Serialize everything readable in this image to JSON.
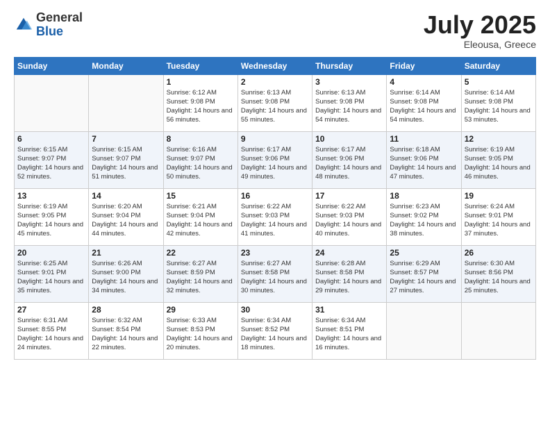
{
  "header": {
    "logo_general": "General",
    "logo_blue": "Blue",
    "month_year": "July 2025",
    "location": "Eleousa, Greece"
  },
  "weekdays": [
    "Sunday",
    "Monday",
    "Tuesday",
    "Wednesday",
    "Thursday",
    "Friday",
    "Saturday"
  ],
  "weeks": [
    [
      {
        "day": "",
        "sunrise": "",
        "sunset": "",
        "daylight": ""
      },
      {
        "day": "",
        "sunrise": "",
        "sunset": "",
        "daylight": ""
      },
      {
        "day": "1",
        "sunrise": "Sunrise: 6:12 AM",
        "sunset": "Sunset: 9:08 PM",
        "daylight": "Daylight: 14 hours and 56 minutes."
      },
      {
        "day": "2",
        "sunrise": "Sunrise: 6:13 AM",
        "sunset": "Sunset: 9:08 PM",
        "daylight": "Daylight: 14 hours and 55 minutes."
      },
      {
        "day": "3",
        "sunrise": "Sunrise: 6:13 AM",
        "sunset": "Sunset: 9:08 PM",
        "daylight": "Daylight: 14 hours and 54 minutes."
      },
      {
        "day": "4",
        "sunrise": "Sunrise: 6:14 AM",
        "sunset": "Sunset: 9:08 PM",
        "daylight": "Daylight: 14 hours and 54 minutes."
      },
      {
        "day": "5",
        "sunrise": "Sunrise: 6:14 AM",
        "sunset": "Sunset: 9:08 PM",
        "daylight": "Daylight: 14 hours and 53 minutes."
      }
    ],
    [
      {
        "day": "6",
        "sunrise": "Sunrise: 6:15 AM",
        "sunset": "Sunset: 9:07 PM",
        "daylight": "Daylight: 14 hours and 52 minutes."
      },
      {
        "day": "7",
        "sunrise": "Sunrise: 6:15 AM",
        "sunset": "Sunset: 9:07 PM",
        "daylight": "Daylight: 14 hours and 51 minutes."
      },
      {
        "day": "8",
        "sunrise": "Sunrise: 6:16 AM",
        "sunset": "Sunset: 9:07 PM",
        "daylight": "Daylight: 14 hours and 50 minutes."
      },
      {
        "day": "9",
        "sunrise": "Sunrise: 6:17 AM",
        "sunset": "Sunset: 9:06 PM",
        "daylight": "Daylight: 14 hours and 49 minutes."
      },
      {
        "day": "10",
        "sunrise": "Sunrise: 6:17 AM",
        "sunset": "Sunset: 9:06 PM",
        "daylight": "Daylight: 14 hours and 48 minutes."
      },
      {
        "day": "11",
        "sunrise": "Sunrise: 6:18 AM",
        "sunset": "Sunset: 9:06 PM",
        "daylight": "Daylight: 14 hours and 47 minutes."
      },
      {
        "day": "12",
        "sunrise": "Sunrise: 6:19 AM",
        "sunset": "Sunset: 9:05 PM",
        "daylight": "Daylight: 14 hours and 46 minutes."
      }
    ],
    [
      {
        "day": "13",
        "sunrise": "Sunrise: 6:19 AM",
        "sunset": "Sunset: 9:05 PM",
        "daylight": "Daylight: 14 hours and 45 minutes."
      },
      {
        "day": "14",
        "sunrise": "Sunrise: 6:20 AM",
        "sunset": "Sunset: 9:04 PM",
        "daylight": "Daylight: 14 hours and 44 minutes."
      },
      {
        "day": "15",
        "sunrise": "Sunrise: 6:21 AM",
        "sunset": "Sunset: 9:04 PM",
        "daylight": "Daylight: 14 hours and 42 minutes."
      },
      {
        "day": "16",
        "sunrise": "Sunrise: 6:22 AM",
        "sunset": "Sunset: 9:03 PM",
        "daylight": "Daylight: 14 hours and 41 minutes."
      },
      {
        "day": "17",
        "sunrise": "Sunrise: 6:22 AM",
        "sunset": "Sunset: 9:03 PM",
        "daylight": "Daylight: 14 hours and 40 minutes."
      },
      {
        "day": "18",
        "sunrise": "Sunrise: 6:23 AM",
        "sunset": "Sunset: 9:02 PM",
        "daylight": "Daylight: 14 hours and 38 minutes."
      },
      {
        "day": "19",
        "sunrise": "Sunrise: 6:24 AM",
        "sunset": "Sunset: 9:01 PM",
        "daylight": "Daylight: 14 hours and 37 minutes."
      }
    ],
    [
      {
        "day": "20",
        "sunrise": "Sunrise: 6:25 AM",
        "sunset": "Sunset: 9:01 PM",
        "daylight": "Daylight: 14 hours and 35 minutes."
      },
      {
        "day": "21",
        "sunrise": "Sunrise: 6:26 AM",
        "sunset": "Sunset: 9:00 PM",
        "daylight": "Daylight: 14 hours and 34 minutes."
      },
      {
        "day": "22",
        "sunrise": "Sunrise: 6:27 AM",
        "sunset": "Sunset: 8:59 PM",
        "daylight": "Daylight: 14 hours and 32 minutes."
      },
      {
        "day": "23",
        "sunrise": "Sunrise: 6:27 AM",
        "sunset": "Sunset: 8:58 PM",
        "daylight": "Daylight: 14 hours and 30 minutes."
      },
      {
        "day": "24",
        "sunrise": "Sunrise: 6:28 AM",
        "sunset": "Sunset: 8:58 PM",
        "daylight": "Daylight: 14 hours and 29 minutes."
      },
      {
        "day": "25",
        "sunrise": "Sunrise: 6:29 AM",
        "sunset": "Sunset: 8:57 PM",
        "daylight": "Daylight: 14 hours and 27 minutes."
      },
      {
        "day": "26",
        "sunrise": "Sunrise: 6:30 AM",
        "sunset": "Sunset: 8:56 PM",
        "daylight": "Daylight: 14 hours and 25 minutes."
      }
    ],
    [
      {
        "day": "27",
        "sunrise": "Sunrise: 6:31 AM",
        "sunset": "Sunset: 8:55 PM",
        "daylight": "Daylight: 14 hours and 24 minutes."
      },
      {
        "day": "28",
        "sunrise": "Sunrise: 6:32 AM",
        "sunset": "Sunset: 8:54 PM",
        "daylight": "Daylight: 14 hours and 22 minutes."
      },
      {
        "day": "29",
        "sunrise": "Sunrise: 6:33 AM",
        "sunset": "Sunset: 8:53 PM",
        "daylight": "Daylight: 14 hours and 20 minutes."
      },
      {
        "day": "30",
        "sunrise": "Sunrise: 6:34 AM",
        "sunset": "Sunset: 8:52 PM",
        "daylight": "Daylight: 14 hours and 18 minutes."
      },
      {
        "day": "31",
        "sunrise": "Sunrise: 6:34 AM",
        "sunset": "Sunset: 8:51 PM",
        "daylight": "Daylight: 14 hours and 16 minutes."
      },
      {
        "day": "",
        "sunrise": "",
        "sunset": "",
        "daylight": ""
      },
      {
        "day": "",
        "sunrise": "",
        "sunset": "",
        "daylight": ""
      }
    ]
  ]
}
